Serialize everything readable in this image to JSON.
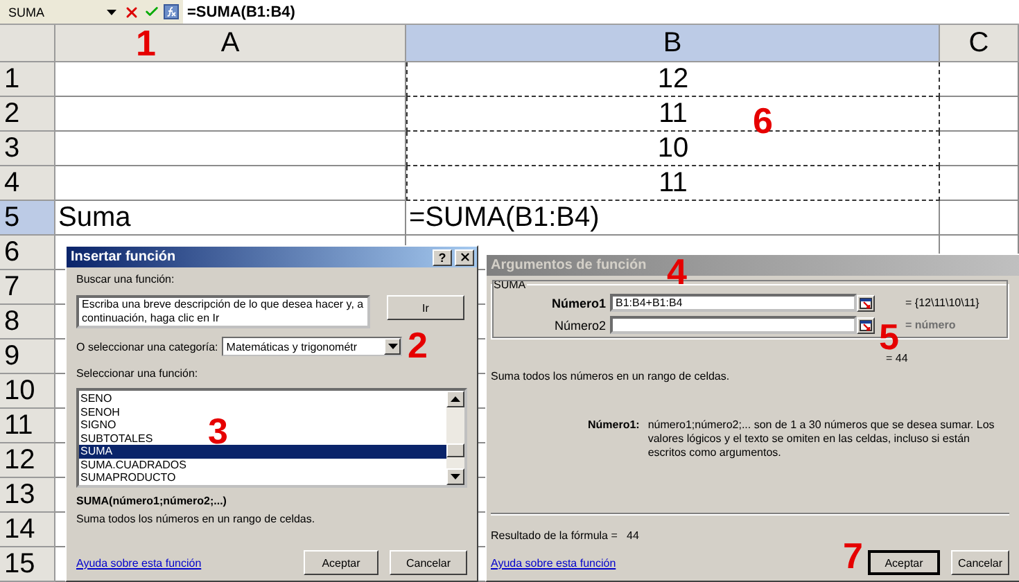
{
  "formula_bar": {
    "name_box": "SUMA",
    "formula": "=SUMA(B1:B4)"
  },
  "columns": [
    {
      "label": "A",
      "selected": false
    },
    {
      "label": "B",
      "selected": true
    },
    {
      "label": "C",
      "selected": false
    }
  ],
  "rows": [
    {
      "number": "1",
      "selected": false,
      "marquee": true,
      "cells": [
        "",
        "12",
        ""
      ]
    },
    {
      "number": "2",
      "selected": false,
      "marquee": true,
      "cells": [
        "",
        "11",
        ""
      ]
    },
    {
      "number": "3",
      "selected": false,
      "marquee": true,
      "cells": [
        "",
        "10",
        ""
      ]
    },
    {
      "number": "4",
      "selected": false,
      "marquee": true,
      "cells": [
        "",
        "11",
        ""
      ]
    },
    {
      "number": "5",
      "selected": true,
      "marquee": false,
      "cells": [
        "Suma",
        "=SUMA(B1:B4)",
        ""
      ]
    },
    {
      "number": "6",
      "selected": false,
      "marquee": false,
      "cells": [
        "",
        "",
        ""
      ]
    },
    {
      "number": "7",
      "selected": false,
      "marquee": false,
      "cells": [
        "",
        ""
      ]
    },
    {
      "number": "8",
      "selected": false,
      "marquee": false,
      "cells": [
        "",
        ""
      ]
    },
    {
      "number": "9",
      "selected": false,
      "marquee": false,
      "cells": [
        "",
        ""
      ]
    },
    {
      "number": "10",
      "selected": false,
      "marquee": false,
      "cells": [
        "",
        ""
      ]
    },
    {
      "number": "11",
      "selected": false,
      "marquee": false,
      "cells": [
        "",
        ""
      ]
    },
    {
      "number": "12",
      "selected": false,
      "marquee": false,
      "cells": [
        "",
        ""
      ]
    },
    {
      "number": "13",
      "selected": false,
      "marquee": false,
      "cells": [
        "",
        ""
      ]
    },
    {
      "number": "14",
      "selected": false,
      "marquee": false,
      "cells": [
        "",
        ""
      ]
    },
    {
      "number": "15",
      "selected": false,
      "marquee": false,
      "cells": [
        "",
        ""
      ]
    }
  ],
  "insert_function_dialog": {
    "title": "Insertar función",
    "active": true,
    "help_button": "?",
    "search_label": "Buscar una función:",
    "search_value": "Escriba una breve descripción de lo que desea hacer y, a continuación, haga clic en Ir",
    "go_button": "Ir",
    "category_label": "O seleccionar una categoría:",
    "category_value": "Matemáticas y trigonométr",
    "function_label": "Seleccionar una función:",
    "functions": [
      {
        "name": "SENO",
        "selected": false
      },
      {
        "name": "SENOH",
        "selected": false
      },
      {
        "name": "SIGNO",
        "selected": false
      },
      {
        "name": "SUBTOTALES",
        "selected": false
      },
      {
        "name": "SUMA",
        "selected": true
      },
      {
        "name": "SUMA.CUADRADOS",
        "selected": false
      },
      {
        "name": "SUMAPRODUCTO",
        "selected": false
      }
    ],
    "signature": "SUMA(número1;número2;...)",
    "description": "Suma todos los números en un rango de celdas.",
    "help_link": "Ayuda sobre esta función",
    "ok_button": "Aceptar",
    "cancel_button": "Cancelar"
  },
  "function_arguments_dialog": {
    "title": "Argumentos de función",
    "active": false,
    "group": "SUMA",
    "arguments": [
      {
        "label": "Número1",
        "selected": true,
        "value": "B1:B4+B1:B4",
        "result": "= {12\\11\\10\\11}"
      },
      {
        "label": "Número2",
        "selected": false,
        "result": "= número"
      }
    ],
    "total": "= 44",
    "description": "Suma todos los números en un rango de celdas.",
    "arg_help_label": "Número1:",
    "arg_help": "número1;número2;... son de 1 a 30 números que se desea sumar. Los valores lógicos y el texto se omiten en las celdas, incluso si están escritos como argumentos.",
    "result_label": "Resultado de la fórmula =",
    "result_value": "44",
    "help_link": "Ayuda sobre esta función",
    "ok_button": "Aceptar",
    "cancel_button": "Cancelar"
  },
  "annotations": [
    {
      "text": "1"
    },
    {
      "text": "2"
    },
    {
      "text": "3"
    },
    {
      "text": "4"
    },
    {
      "text": "5"
    },
    {
      "text": "6"
    },
    {
      "text": "7"
    }
  ]
}
